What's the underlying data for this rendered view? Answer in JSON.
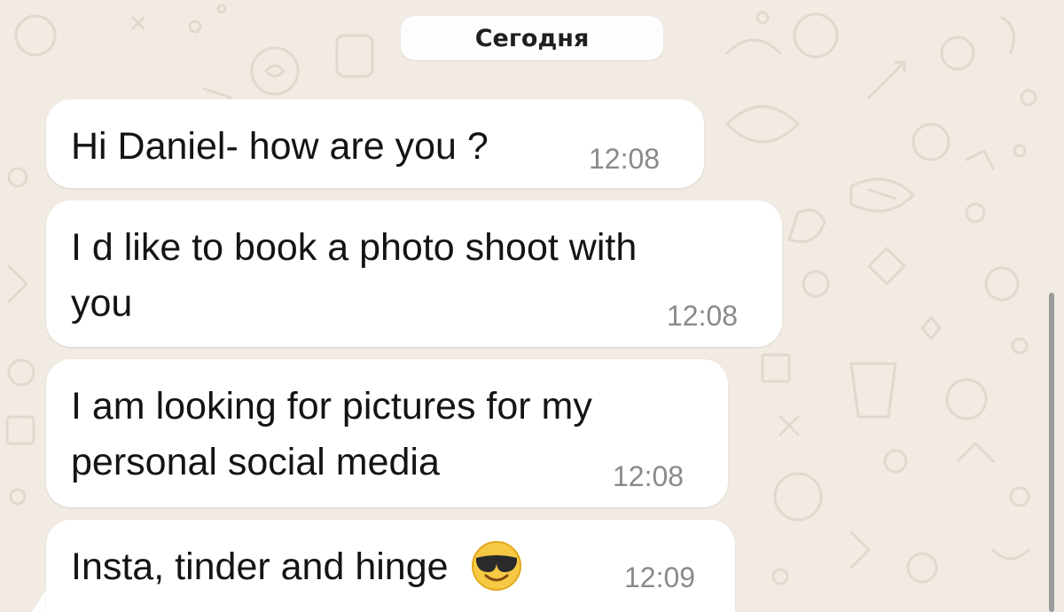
{
  "chat": {
    "date_label": "Сегодня",
    "messages": [
      {
        "text_lines": [
          "Hi Daniel- how are you ?"
        ],
        "time": "12:08"
      },
      {
        "text_lines": [
          "I d like to book a photo shoot with",
          "you"
        ],
        "time": "12:08"
      },
      {
        "text_lines": [
          "I am looking for pictures for my",
          "personal social media"
        ],
        "time": "12:08"
      },
      {
        "text": "Insta, tinder and hinge",
        "emoji": "smiling-face-with-sunglasses-icon",
        "time": "12:09"
      }
    ]
  },
  "colors": {
    "wallpaper": "#f1ebe3",
    "doodle": "#e2d9cc",
    "bubble": "#ffffff",
    "timestamp": "#8a8a8a",
    "scrollbar": "#9c9c9c"
  }
}
